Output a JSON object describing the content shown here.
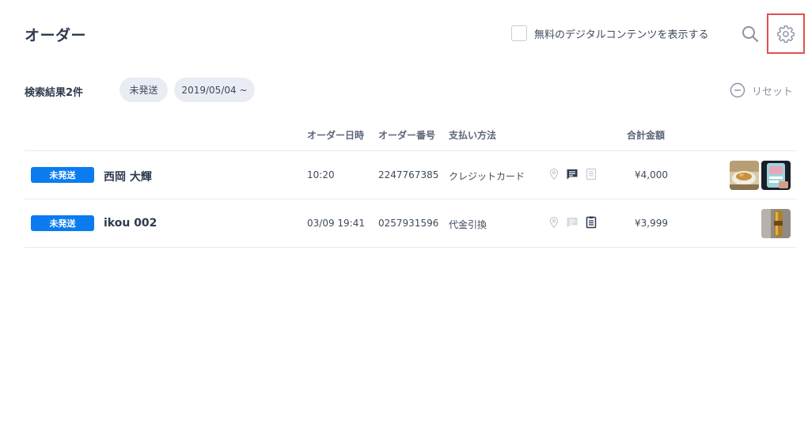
{
  "header": {
    "title": "オーダー",
    "free_content_label": "無料のデジタルコンテンツを表示する"
  },
  "filters": {
    "result_count": "検索結果2件",
    "status_chip": "未発送",
    "date_chip": "2019/05/04 ~",
    "reset_label": "リセット"
  },
  "table": {
    "columns": {
      "order_time": "オーダー日時",
      "order_number": "オーダー番号",
      "payment_method": "支払い方法",
      "total": "合計金額"
    },
    "rows": [
      {
        "status": "未発送",
        "customer": "西岡 大輝",
        "order_time": "10:20",
        "order_number": "2247767385",
        "payment_method": "クレジットカード",
        "total": "¥4,000",
        "icons": [
          "location-pin-icon",
          "message-icon",
          "receipt-icon"
        ],
        "thumbnails": [
          "food-bowl-thumbnail",
          "phone-screen-thumbnail"
        ]
      },
      {
        "status": "未発送",
        "customer": "ikou 002",
        "order_time": "03/09 19:41",
        "order_number": "0257931596",
        "payment_method": "代金引換",
        "total": "¥3,999",
        "icons": [
          "location-pin-icon",
          "message-icon",
          "receipt-icon"
        ],
        "thumbnails": [
          "bottle-thumbnail"
        ]
      }
    ]
  },
  "colors": {
    "badge_blue": "#0a7cf0",
    "chip_bg": "#e9ecf2",
    "highlight_red": "#e05050",
    "text_dark": "#2e3a4f"
  }
}
